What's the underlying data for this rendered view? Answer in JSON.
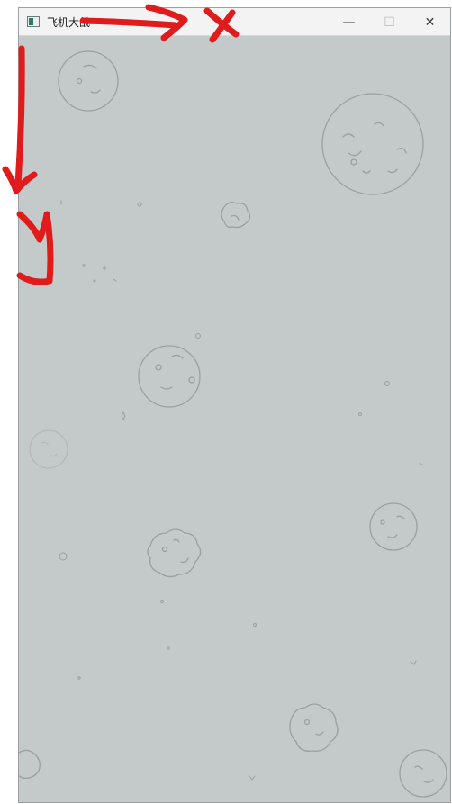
{
  "window": {
    "title": "飞机大战",
    "minimize_glyph": "—",
    "maximize_glyph": "☐",
    "close_glyph": "✕",
    "icon": "app-window-icon"
  },
  "colors": {
    "background": "#c4c9c9",
    "asteroid_outline": "#9aa1a1",
    "annotation": "#e01b1b"
  },
  "game": {
    "scene": "space-asteroid-field",
    "annotations": [
      "right-arrow",
      "x-mark",
      "down-arrow",
      "squiggle"
    ]
  }
}
